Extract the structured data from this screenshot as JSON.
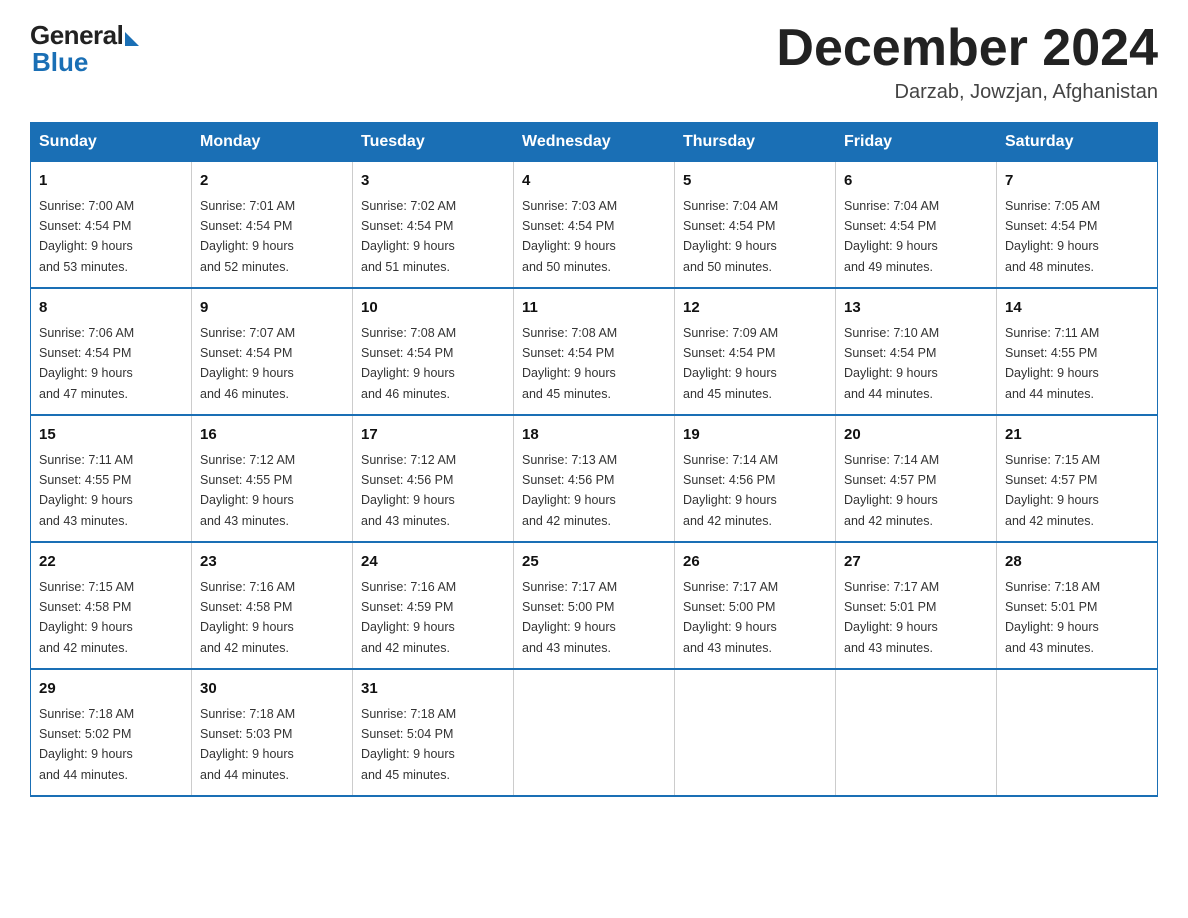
{
  "logo": {
    "general": "General",
    "blue": "Blue"
  },
  "title": "December 2024",
  "location": "Darzab, Jowzjan, Afghanistan",
  "days_of_week": [
    "Sunday",
    "Monday",
    "Tuesday",
    "Wednesday",
    "Thursday",
    "Friday",
    "Saturday"
  ],
  "weeks": [
    [
      {
        "num": "1",
        "sunrise": "7:00 AM",
        "sunset": "4:54 PM",
        "daylight": "9 hours and 53 minutes."
      },
      {
        "num": "2",
        "sunrise": "7:01 AM",
        "sunset": "4:54 PM",
        "daylight": "9 hours and 52 minutes."
      },
      {
        "num": "3",
        "sunrise": "7:02 AM",
        "sunset": "4:54 PM",
        "daylight": "9 hours and 51 minutes."
      },
      {
        "num": "4",
        "sunrise": "7:03 AM",
        "sunset": "4:54 PM",
        "daylight": "9 hours and 50 minutes."
      },
      {
        "num": "5",
        "sunrise": "7:04 AM",
        "sunset": "4:54 PM",
        "daylight": "9 hours and 50 minutes."
      },
      {
        "num": "6",
        "sunrise": "7:04 AM",
        "sunset": "4:54 PM",
        "daylight": "9 hours and 49 minutes."
      },
      {
        "num": "7",
        "sunrise": "7:05 AM",
        "sunset": "4:54 PM",
        "daylight": "9 hours and 48 minutes."
      }
    ],
    [
      {
        "num": "8",
        "sunrise": "7:06 AM",
        "sunset": "4:54 PM",
        "daylight": "9 hours and 47 minutes."
      },
      {
        "num": "9",
        "sunrise": "7:07 AM",
        "sunset": "4:54 PM",
        "daylight": "9 hours and 46 minutes."
      },
      {
        "num": "10",
        "sunrise": "7:08 AM",
        "sunset": "4:54 PM",
        "daylight": "9 hours and 46 minutes."
      },
      {
        "num": "11",
        "sunrise": "7:08 AM",
        "sunset": "4:54 PM",
        "daylight": "9 hours and 45 minutes."
      },
      {
        "num": "12",
        "sunrise": "7:09 AM",
        "sunset": "4:54 PM",
        "daylight": "9 hours and 45 minutes."
      },
      {
        "num": "13",
        "sunrise": "7:10 AM",
        "sunset": "4:54 PM",
        "daylight": "9 hours and 44 minutes."
      },
      {
        "num": "14",
        "sunrise": "7:11 AM",
        "sunset": "4:55 PM",
        "daylight": "9 hours and 44 minutes."
      }
    ],
    [
      {
        "num": "15",
        "sunrise": "7:11 AM",
        "sunset": "4:55 PM",
        "daylight": "9 hours and 43 minutes."
      },
      {
        "num": "16",
        "sunrise": "7:12 AM",
        "sunset": "4:55 PM",
        "daylight": "9 hours and 43 minutes."
      },
      {
        "num": "17",
        "sunrise": "7:12 AM",
        "sunset": "4:56 PM",
        "daylight": "9 hours and 43 minutes."
      },
      {
        "num": "18",
        "sunrise": "7:13 AM",
        "sunset": "4:56 PM",
        "daylight": "9 hours and 42 minutes."
      },
      {
        "num": "19",
        "sunrise": "7:14 AM",
        "sunset": "4:56 PM",
        "daylight": "9 hours and 42 minutes."
      },
      {
        "num": "20",
        "sunrise": "7:14 AM",
        "sunset": "4:57 PM",
        "daylight": "9 hours and 42 minutes."
      },
      {
        "num": "21",
        "sunrise": "7:15 AM",
        "sunset": "4:57 PM",
        "daylight": "9 hours and 42 minutes."
      }
    ],
    [
      {
        "num": "22",
        "sunrise": "7:15 AM",
        "sunset": "4:58 PM",
        "daylight": "9 hours and 42 minutes."
      },
      {
        "num": "23",
        "sunrise": "7:16 AM",
        "sunset": "4:58 PM",
        "daylight": "9 hours and 42 minutes."
      },
      {
        "num": "24",
        "sunrise": "7:16 AM",
        "sunset": "4:59 PM",
        "daylight": "9 hours and 42 minutes."
      },
      {
        "num": "25",
        "sunrise": "7:17 AM",
        "sunset": "5:00 PM",
        "daylight": "9 hours and 43 minutes."
      },
      {
        "num": "26",
        "sunrise": "7:17 AM",
        "sunset": "5:00 PM",
        "daylight": "9 hours and 43 minutes."
      },
      {
        "num": "27",
        "sunrise": "7:17 AM",
        "sunset": "5:01 PM",
        "daylight": "9 hours and 43 minutes."
      },
      {
        "num": "28",
        "sunrise": "7:18 AM",
        "sunset": "5:01 PM",
        "daylight": "9 hours and 43 minutes."
      }
    ],
    [
      {
        "num": "29",
        "sunrise": "7:18 AM",
        "sunset": "5:02 PM",
        "daylight": "9 hours and 44 minutes."
      },
      {
        "num": "30",
        "sunrise": "7:18 AM",
        "sunset": "5:03 PM",
        "daylight": "9 hours and 44 minutes."
      },
      {
        "num": "31",
        "sunrise": "7:18 AM",
        "sunset": "5:04 PM",
        "daylight": "9 hours and 45 minutes."
      },
      null,
      null,
      null,
      null
    ]
  ],
  "labels": {
    "sunrise": "Sunrise:",
    "sunset": "Sunset:",
    "daylight": "Daylight:"
  }
}
